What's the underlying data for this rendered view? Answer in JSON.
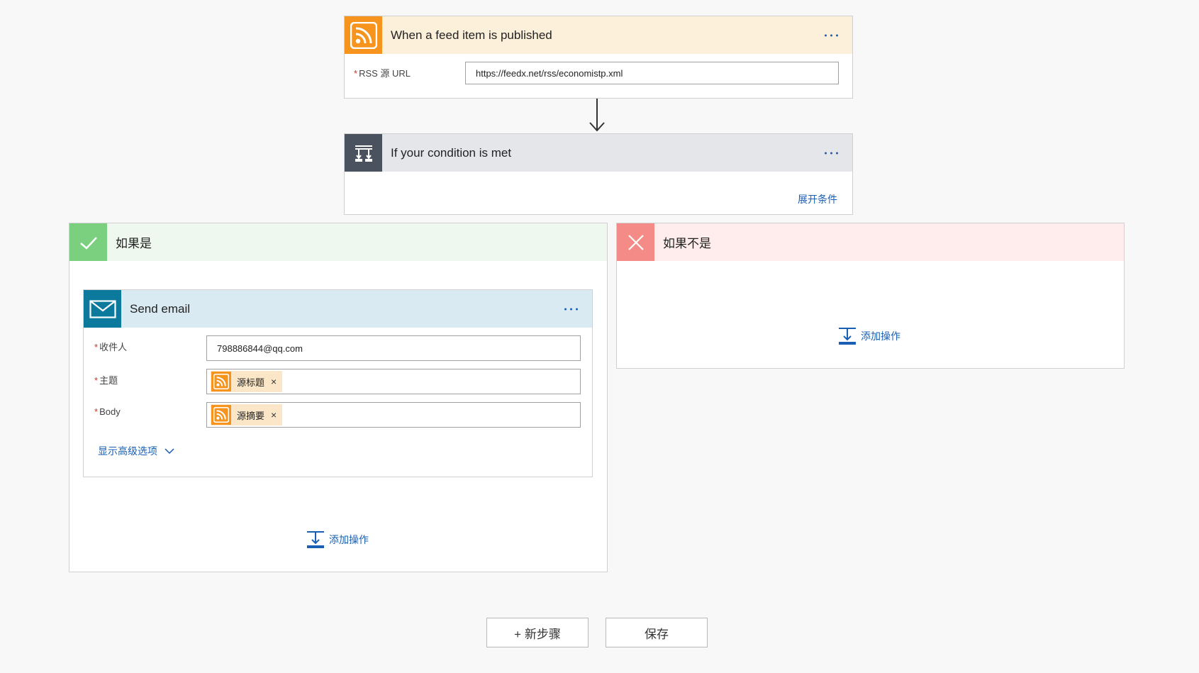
{
  "trigger": {
    "title": "When a feed item is published",
    "rss_label": "RSS 源 URL",
    "rss_value": "https://feedx.net/rss/economistp.xml",
    "icon": "rss-icon",
    "color": "#f7941d",
    "header_bg": "#fdf0db"
  },
  "condition": {
    "title": "If your condition is met",
    "expand_label": "展开条件",
    "icon": "condition-icon",
    "color": "#4a5260",
    "header_bg": "#e4e6ea"
  },
  "branch_yes": {
    "title": "如果是",
    "color": "#7ad07f",
    "header_bg": "#eef8ee",
    "add_action_label": "添加操作"
  },
  "branch_no": {
    "title": "如果不是",
    "color": "#f48b86",
    "header_bg": "#ffecec",
    "add_action_label": "添加操作"
  },
  "send_email": {
    "title": "Send email",
    "icon": "mail-icon",
    "color": "#0b7a9c",
    "header_bg": "#d9eaf2",
    "to_label": "收件人",
    "to_value": "798886844@qq.com",
    "subject_label": "主题",
    "subject_token": "源标题",
    "body_label": "Body",
    "body_token": "源摘要",
    "token_remove": "×",
    "advanced_label": "显示高级选项"
  },
  "footer": {
    "new_step_label": "+ 新步骤",
    "save_label": "保存"
  },
  "required_mark": "*"
}
